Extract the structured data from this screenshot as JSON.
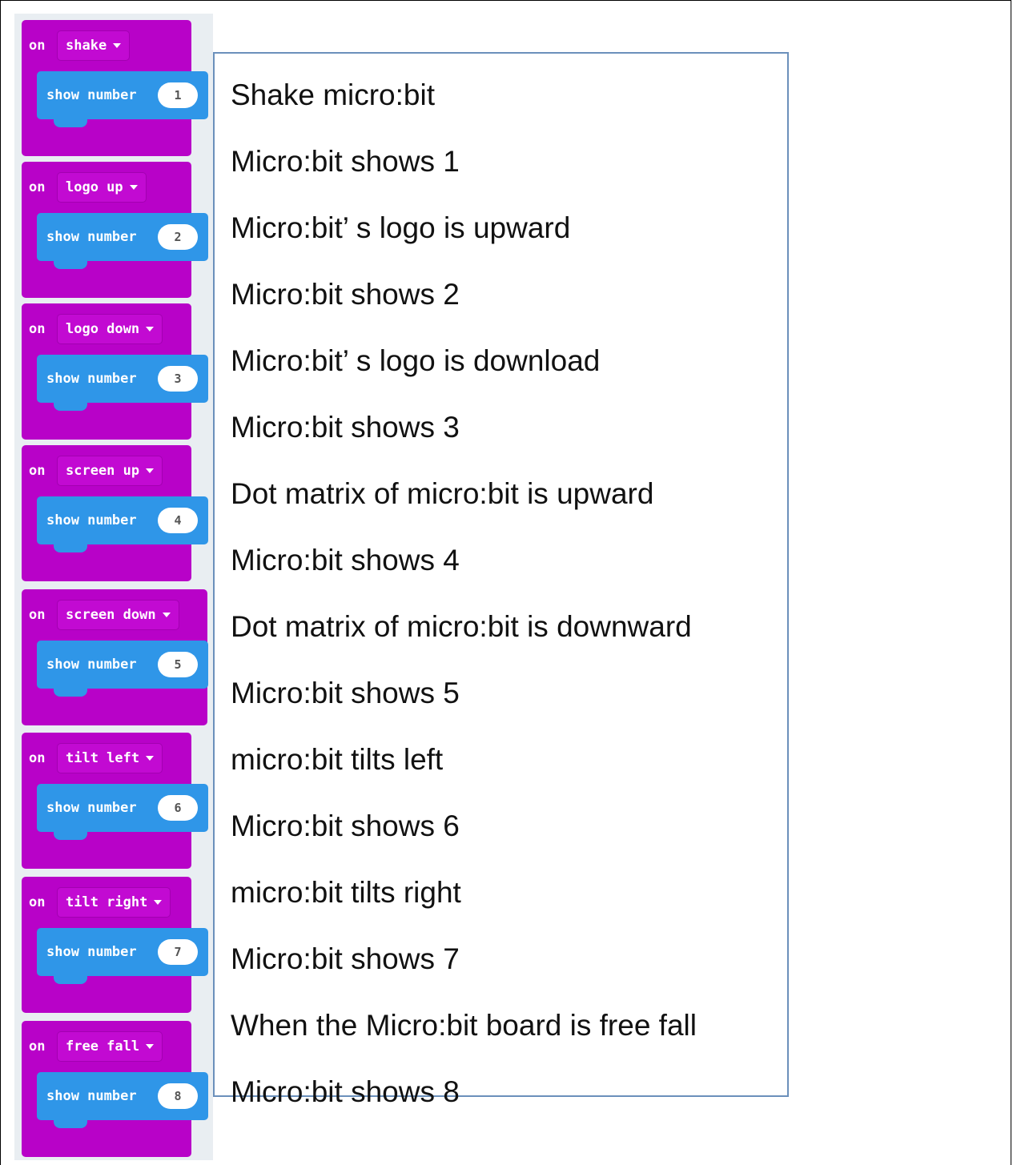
{
  "blocks": [
    {
      "event": "shake",
      "show_label": "show number",
      "number": "1"
    },
    {
      "event": "logo up",
      "show_label": "show number",
      "number": "2"
    },
    {
      "event": "logo down",
      "show_label": "show number",
      "number": "3"
    },
    {
      "event": "screen up",
      "show_label": "show number",
      "number": "4"
    },
    {
      "event": "screen down",
      "show_label": "show number",
      "number": "5"
    },
    {
      "event": "tilt left",
      "show_label": "show number",
      "number": "6"
    },
    {
      "event": "tilt right",
      "show_label": "show number",
      "number": "7"
    },
    {
      "event": "free fall",
      "show_label": "show number",
      "number": "8"
    }
  ],
  "on_label": "on",
  "steps": [
    "Shake micro:bit",
    "Micro:bit shows 1",
    "Micro:bit’ s logo is upward",
    "Micro:bit shows 2",
    "Micro:bit’ s logo is download",
    "Micro:bit shows 3",
    "Dot matrix of micro:bit is upward",
    "Micro:bit shows 4",
    "Dot matrix of micro:bit is downward",
    "Micro:bit shows 5",
    "micro:bit tilts left",
    "Micro:bit shows 6",
    "micro:bit tilts right",
    "Micro:bit shows 7",
    "When the Micro:bit board is free fall",
    "Micro:bit shows 8"
  ],
  "colors": {
    "event_block": "#b802c8",
    "show_block": "#2f96e8",
    "box_border": "#6b90bb"
  }
}
